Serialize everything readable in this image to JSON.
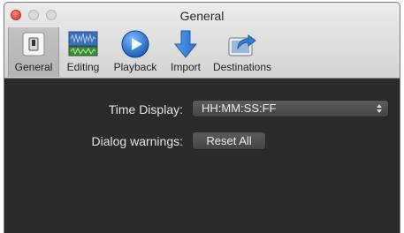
{
  "window": {
    "title": "General"
  },
  "toolbar": {
    "items": [
      {
        "label": "General",
        "icon": "general-switch-icon",
        "selected": true
      },
      {
        "label": "Editing",
        "icon": "editing-waveform-icon",
        "selected": false
      },
      {
        "label": "Playback",
        "icon": "playback-play-icon",
        "selected": false
      },
      {
        "label": "Import",
        "icon": "import-arrow-icon",
        "selected": false
      },
      {
        "label": "Destinations",
        "icon": "destinations-share-icon",
        "selected": false
      }
    ]
  },
  "general": {
    "time_display_label": "Time Display:",
    "time_display_value": "HH:MM:SS:FF",
    "dialog_warnings_label": "Dialog warnings:",
    "reset_all_label": "Reset All"
  },
  "colors": {
    "content_background": "#2b2b2b",
    "titlebar_background": "#e0e0e0",
    "close_button": "#e0443a",
    "accent_blue": "#2f7fd6"
  }
}
